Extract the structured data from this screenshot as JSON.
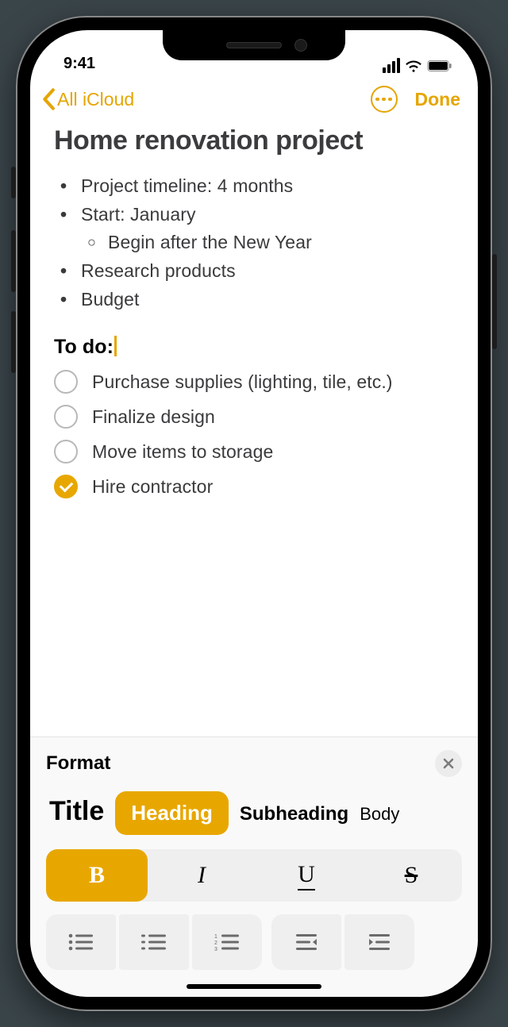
{
  "status": {
    "time": "9:41"
  },
  "nav": {
    "back_label": "All iCloud",
    "done_label": "Done"
  },
  "note": {
    "title": "Home renovation project",
    "bullets": [
      {
        "text": "Project timeline: 4 months"
      },
      {
        "text": "Start: January",
        "children": [
          "Begin after the New Year"
        ]
      },
      {
        "text": "Research products"
      },
      {
        "text": "Budget"
      }
    ],
    "heading": "To do:",
    "todos": [
      {
        "label": "Purchase supplies (lighting, tile, etc.)",
        "done": false
      },
      {
        "label": "Finalize design",
        "done": false
      },
      {
        "label": "Move items to storage",
        "done": false
      },
      {
        "label": "Hire contractor",
        "done": true
      }
    ]
  },
  "format": {
    "title": "Format",
    "styles": {
      "title": "Title",
      "heading": "Heading",
      "subheading": "Subheading",
      "body": "Body",
      "selected": "heading"
    },
    "bius": {
      "bold_active": true
    },
    "colors": {
      "accent": "#e8a700"
    }
  }
}
